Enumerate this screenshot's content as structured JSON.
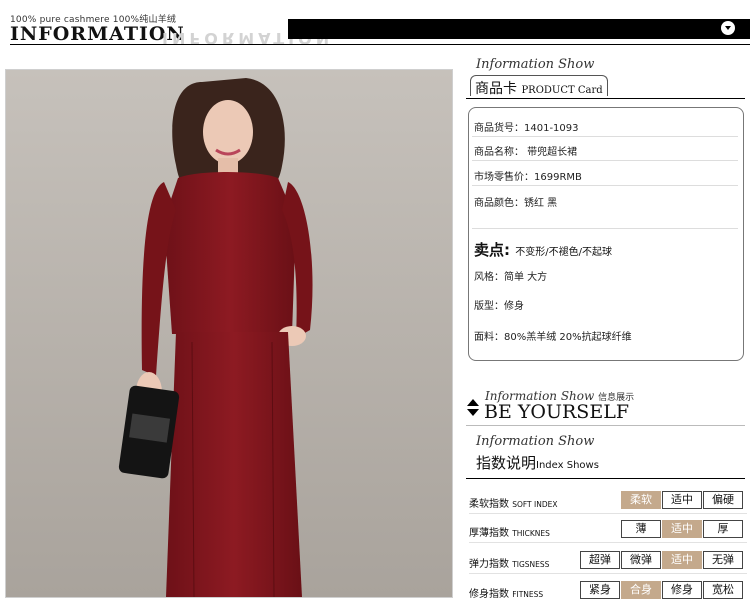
{
  "header": {
    "tagline": "100% pure cashmere 100%纯山羊绒",
    "brand": "INFORMATION",
    "brand_reflection": "INFORMATION"
  },
  "card": {
    "script_title": "Information Show",
    "tab_cn": "商品卡",
    "tab_en": "PRODUCT Card",
    "rows": [
      "商品货号：1401-1093",
      "商品名称： 带兜超长裙",
      "市场零售价：1699RMB",
      "商品颜色：锈红  黑"
    ],
    "sell_label": "卖点:",
    "sell_text": "不变形/不褪色/不起球",
    "details": [
      "风格：简单  大方",
      "版型：修身",
      "面料：80%羔羊绒  20%抗起球纤维"
    ]
  },
  "be_yourself": {
    "script": "Information Show",
    "cn": "信息展示",
    "title": "BE YOURSELF"
  },
  "index": {
    "script_title": "Information Show",
    "title_cn": "指数说明",
    "title_en": "Index Shows",
    "highlight_color": "#c4a98c",
    "rows": [
      {
        "cn": "柔软指数",
        "en": "SOFT INDEX",
        "options": [
          "柔软",
          "适中",
          "偏硬"
        ],
        "selected": 0
      },
      {
        "cn": "厚薄指数",
        "en": "THICKNES",
        "options": [
          "薄",
          "适中",
          "厚"
        ],
        "selected": 1
      },
      {
        "cn": "弹力指数",
        "en": "TIGSNESS",
        "options": [
          "超弹",
          "微弹",
          "适中",
          "无弹"
        ],
        "selected": 2
      },
      {
        "cn": "修身指数",
        "en": "FITNESS",
        "options": [
          "紧身",
          "合身",
          "修身",
          "宽松"
        ],
        "selected": 1
      }
    ]
  }
}
